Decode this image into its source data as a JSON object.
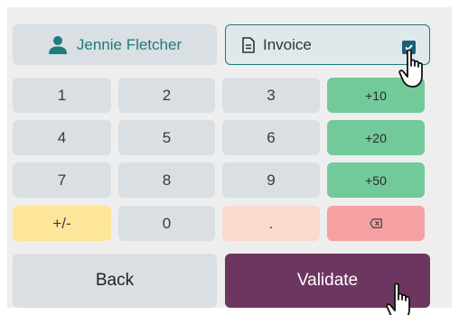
{
  "header": {
    "customer_name": "Jennie Fletcher",
    "invoice_label": "Invoice",
    "invoice_checked": true
  },
  "keypad": {
    "row1": [
      "1",
      "2",
      "3",
      "+10"
    ],
    "row2": [
      "4",
      "5",
      "6",
      "+20"
    ],
    "row3": [
      "7",
      "8",
      "9",
      "+50"
    ],
    "row4": [
      "+/-",
      "0",
      "."
    ]
  },
  "actions": {
    "back_label": "Back",
    "validate_label": "Validate"
  },
  "icons": {
    "customer": "person-icon",
    "invoice": "document-icon",
    "backspace": "backspace-icon",
    "cursor": "hand-pointer-icon"
  },
  "colors": {
    "accent_teal": "#1c7d7a",
    "validate_bg": "#6d3660",
    "quick_add_green": "#72c99a",
    "sign_toggle_yellow": "#fde69a",
    "backspace_red": "#f6a1a1"
  }
}
